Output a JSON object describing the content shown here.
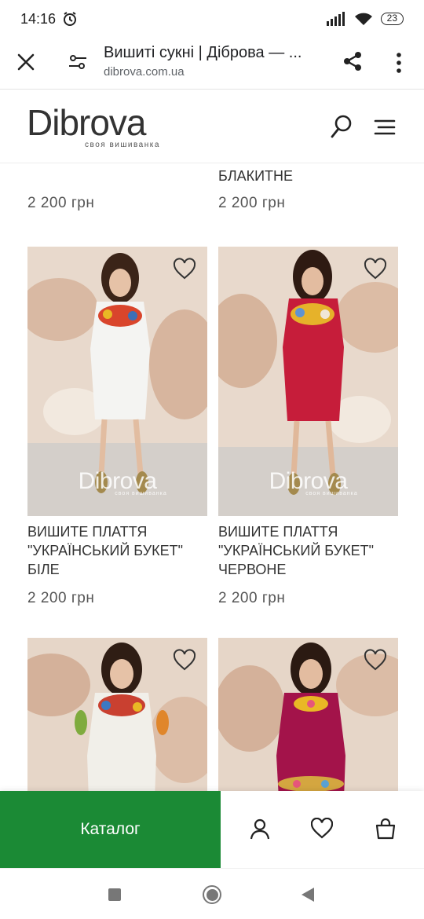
{
  "status_bar": {
    "time": "14:16",
    "battery": "23"
  },
  "browser": {
    "title": "Вишиті сукні | Діброва — ...",
    "url": "dibrova.com.ua"
  },
  "site": {
    "logo_text": "Dibrova",
    "logo_tagline": "своя вишиванка"
  },
  "previous_row": {
    "right_name": "БЛАКИТНЕ",
    "left_price": "2 200 грн",
    "right_price": "2 200 грн"
  },
  "products": [
    {
      "name": "ВИШИТЕ ПЛАТТЯ \"УКРАЇНСЬКИЙ БУКЕТ\" БІЛЕ",
      "price": "2 200 грн",
      "dress_color": "#f4f4f2",
      "watermark": "Dibrova",
      "watermark_sub": "своя вишиванка"
    },
    {
      "name": "ВИШИТЕ ПЛАТТЯ \"УКРАЇНСЬКИЙ БУКЕТ\" ЧЕРВОНЕ",
      "price": "2 200 грн",
      "dress_color": "#c61d3a",
      "watermark": "Dibrova",
      "watermark_sub": "своя вишиванка"
    },
    {
      "name": "",
      "price": "",
      "dress_color": "#f1efe9"
    },
    {
      "name": "",
      "price": "",
      "dress_color": "#a3134a"
    }
  ],
  "bottom_bar": {
    "catalog_label": "Каталог",
    "catalog_color": "#1b8a35"
  },
  "icons": {
    "close": "close-icon",
    "tune": "tune-icon",
    "share": "share-icon",
    "more": "more-vert-icon",
    "search": "search-icon",
    "menu": "menu-icon",
    "wishlist": "heart-icon",
    "account": "user-icon",
    "cart": "bag-icon"
  }
}
